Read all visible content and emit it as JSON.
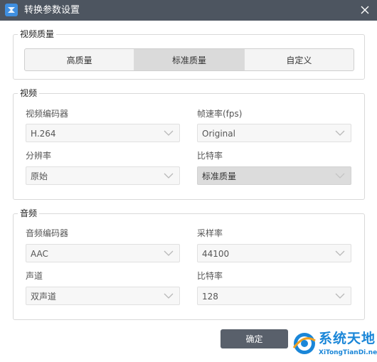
{
  "window": {
    "title": "转换参数设置",
    "close_icon": "close-icon"
  },
  "quality": {
    "title": "视频质量",
    "options": [
      "高质量",
      "标准质量",
      "自定义"
    ],
    "selected": "标准质量"
  },
  "video": {
    "title": "视频",
    "encoder_label": "视频编码器",
    "encoder_value": "H.264",
    "fps_label": "帧速率(fps)",
    "fps_value": "Original",
    "resolution_label": "分辨率",
    "resolution_value": "原始",
    "bitrate_label": "比特率",
    "bitrate_value": "标准质量"
  },
  "audio": {
    "title": "音频",
    "encoder_label": "音频编码器",
    "encoder_value": "AAC",
    "samplerate_label": "采样率",
    "samplerate_value": "44100",
    "channel_label": "声道",
    "channel_value": "双声道",
    "bitrate_label": "比特率",
    "bitrate_value": "128"
  },
  "footer": {
    "ok_label": "确定"
  },
  "watermark": {
    "text": "系统天地",
    "subtext": "XiTongTianDi.net"
  },
  "colors": {
    "titlebar": "#4d5560",
    "ok_button": "#59606b",
    "selected_segment": "#dadada",
    "watermark_blue": "#1a86d8"
  }
}
